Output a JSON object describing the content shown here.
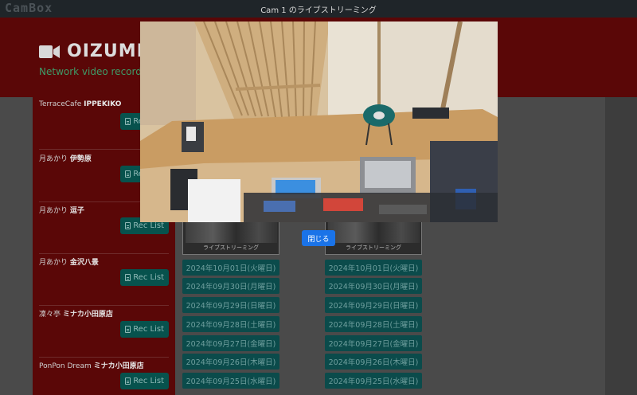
{
  "navbar": {
    "brand": "CamBox",
    "title": "Cam 1 のライブストリーミング"
  },
  "header": {
    "site_title": "OIZUMI",
    "tagline": "Network video recorde"
  },
  "sidebar": {
    "rec_label": "Rec List",
    "items": [
      {
        "prefix": "TerraceCafe",
        "name": "IPPEKIKO"
      },
      {
        "prefix": "月あかり",
        "name": "伊勢原"
      },
      {
        "prefix": "月あかり",
        "name": "逗子"
      },
      {
        "prefix": "月あかり",
        "name": "金沢八景"
      },
      {
        "prefix": "凜々亭",
        "name": "ミナカ小田原店"
      },
      {
        "prefix": "PonPon Dream",
        "name": "ミナカ小田原店"
      }
    ]
  },
  "cameras": [
    {
      "caption": "ライブストリーミング",
      "dates": [
        "2024年10月01日(火曜日)",
        "2024年09月30日(月曜日)",
        "2024年09月29日(日曜日)",
        "2024年09月28日(土曜日)",
        "2024年09月27日(金曜日)",
        "2024年09月26日(木曜日)",
        "2024年09月25日(水曜日)"
      ]
    },
    {
      "caption": "ライブストリーミング",
      "dates": [
        "2024年10月01日(火曜日)",
        "2024年09月30日(月曜日)",
        "2024年09月29日(日曜日)",
        "2024年09月28日(土曜日)",
        "2024年09月27日(金曜日)",
        "2024年09月26日(木曜日)",
        "2024年09月25日(水曜日)"
      ]
    }
  ],
  "modal": {
    "close_label": "閉じる"
  }
}
